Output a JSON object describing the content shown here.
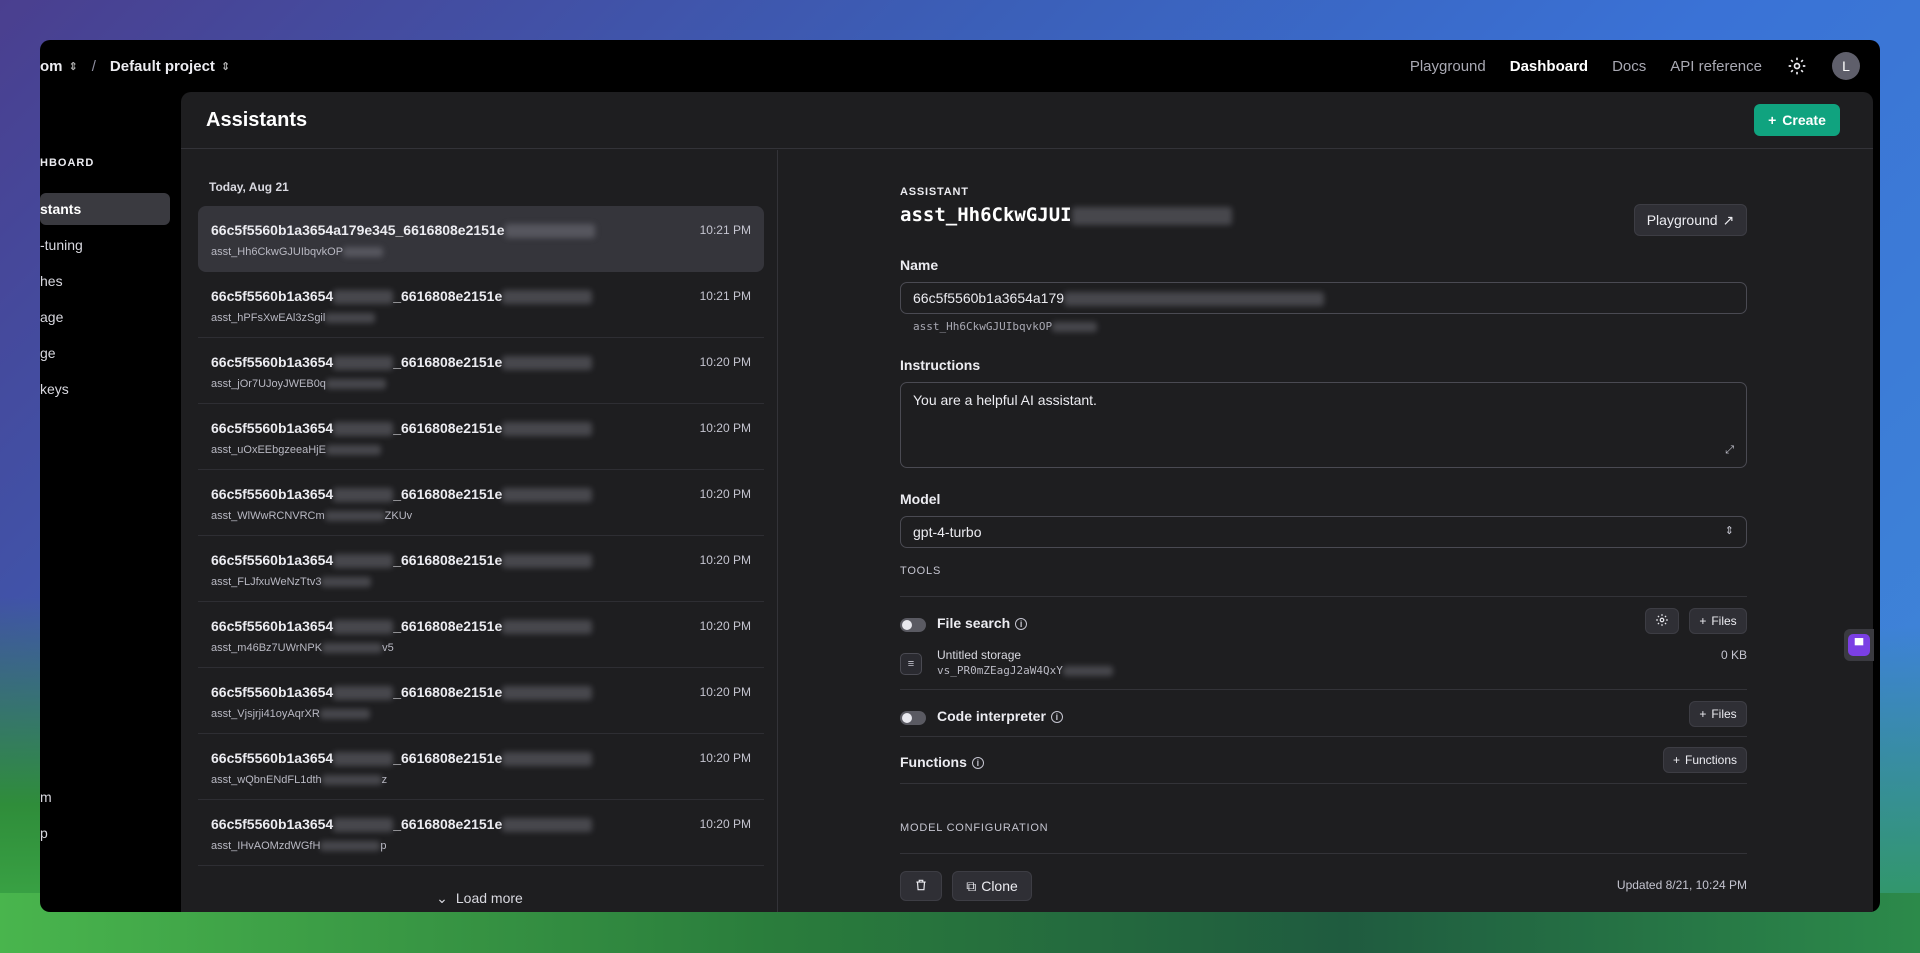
{
  "breadcrumb": {
    "org": "om",
    "separator": "/",
    "project": "Default project"
  },
  "topnav": {
    "playground": "Playground",
    "dashboard": "Dashboard",
    "docs": "Docs",
    "api_reference": "API reference",
    "avatar_initial": "L"
  },
  "sidebar": {
    "heading": "HBOARD",
    "items": [
      {
        "label": "stants"
      },
      {
        "label": "-tuning"
      },
      {
        "label": "hes"
      },
      {
        "label": "age"
      },
      {
        "label": "ge"
      },
      {
        "label": "keys"
      }
    ],
    "bottom_items": [
      {
        "label": "m"
      },
      {
        "label": "p"
      }
    ]
  },
  "header": {
    "title": "Assistants",
    "create_label": "Create"
  },
  "list": {
    "date_label": "Today, Aug 21",
    "rows": [
      {
        "name": "66c5f5560b1a3654a179e345_6616808e2151e",
        "id": "asst_Hh6CkwGJUIbqvkOP",
        "time": "10:21 PM"
      },
      {
        "name": "66c5f5560b1a3654",
        "name_tail": "_6616808e2151e",
        "id": "asst_hPFsXwEAl3zSgil",
        "time": "10:21 PM"
      },
      {
        "name": "66c5f5560b1a3654",
        "name_tail": "_6616808e2151e",
        "id": "asst_jOr7UJoyJWEB0q",
        "time": "10:20 PM"
      },
      {
        "name": "66c5f5560b1a3654",
        "name_tail": "_6616808e2151e",
        "id": "asst_uOxEEbgzeeaHjE",
        "time": "10:20 PM"
      },
      {
        "name": "66c5f5560b1a3654",
        "name_tail": "_6616808e2151e",
        "id": "asst_WlWwRCNVRCm",
        "id_tail": "ZKUv",
        "time": "10:20 PM"
      },
      {
        "name": "66c5f5560b1a3654",
        "name_tail": "_6616808e2151e",
        "id": "asst_FLJfxuWeNzTtv3",
        "time": "10:20 PM"
      },
      {
        "name": "66c5f5560b1a3654",
        "name_tail": "_6616808e2151e",
        "id": "asst_m46Bz7UWrNPK",
        "id_tail": "v5",
        "time": "10:20 PM"
      },
      {
        "name": "66c5f5560b1a3654",
        "name_tail": "_6616808e2151e",
        "id": "asst_Vjsjrji41oyAqrXR",
        "time": "10:20 PM"
      },
      {
        "name": "66c5f5560b1a3654",
        "name_tail": "_6616808e2151e",
        "id": "asst_wQbnENdFL1dth",
        "id_tail": "z",
        "time": "10:20 PM"
      },
      {
        "name": "66c5f5560b1a3654",
        "name_tail": "_6616808e2151e",
        "id": "asst_IHvAOMzdWGfH",
        "id_tail": "p",
        "time": "10:20 PM"
      }
    ],
    "load_more": "Load more"
  },
  "detail": {
    "section_label": "ASSISTANT",
    "assistant_id": "asst_Hh6CkwGJUI",
    "playground_button": "Playground",
    "name_label": "Name",
    "name_value": "66c5f5560b1a3654a179",
    "name_subid": "asst_Hh6CkwGJUIbqvkOP",
    "instructions_label": "Instructions",
    "instructions_value": "You are a helpful AI assistant.",
    "model_label": "Model",
    "model_value": "gpt-4-turbo",
    "tools_label": "TOOLS",
    "file_search_label": "File search",
    "files_button": "Files",
    "storage_name": "Untitled storage",
    "storage_id": "vs_PR0mZEagJ2aW4QxY",
    "storage_size": "0 KB",
    "code_interpreter_label": "Code interpreter",
    "functions_label": "Functions",
    "functions_button": "Functions",
    "model_config_label": "MODEL CONFIGURATION",
    "clone_button": "Clone",
    "updated_text": "Updated 8/21, 10:24 PM"
  },
  "colors": {
    "accent": "#10a37f",
    "panel_bg": "#1e1e20"
  }
}
